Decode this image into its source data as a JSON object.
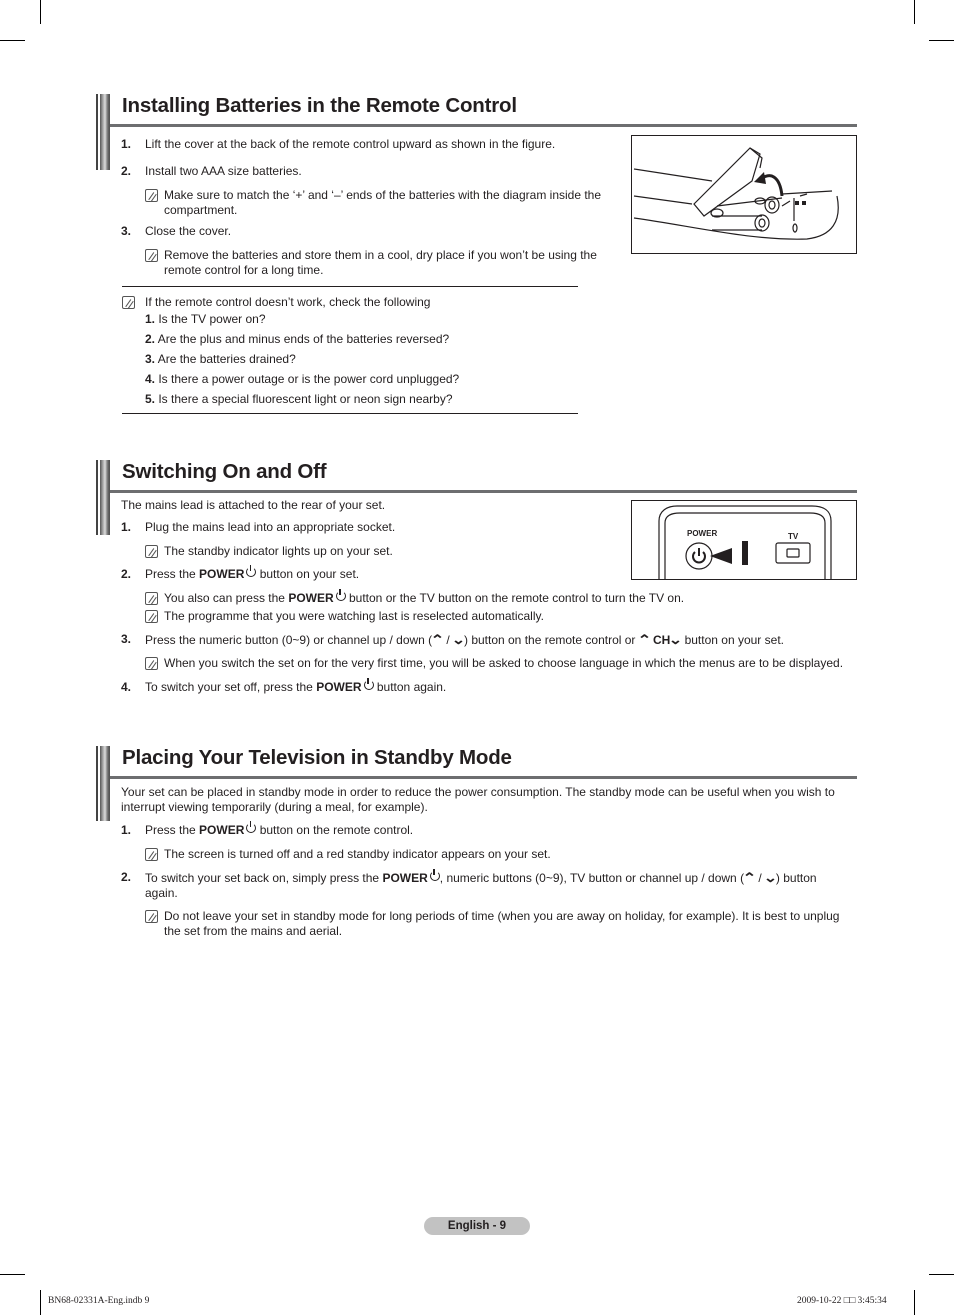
{
  "sections": {
    "batteries": {
      "title": "Installing Batteries in the Remote Control",
      "steps": [
        {
          "num": "1.",
          "text": "Lift the cover at the back of the remote control upward as shown in the figure."
        },
        {
          "num": "2.",
          "text": "Install two AAA size batteries."
        },
        {
          "num": "3.",
          "text": "Close the cover."
        }
      ],
      "notes": [
        "Make sure to match the ‘+’ and ‘–’ ends of the batteries with the diagram inside the compartment.",
        "Remove the batteries and store them in a cool, dry place if you won’t be using the remote control for a long time."
      ],
      "check": {
        "intro": "If the remote control doesn’t work, check the following",
        "items": [
          {
            "num": "1.",
            "text": " Is the TV power on?"
          },
          {
            "num": "2.",
            "text": " Are the plus and minus ends of the batteries reversed?"
          },
          {
            "num": "3.",
            "text": " Are the batteries drained?"
          },
          {
            "num": "4.",
            "text": " Is there a power outage or is the power cord unplugged?"
          },
          {
            "num": "5.",
            "text": " Is there a special fluorescent light or neon sign nearby?"
          }
        ]
      },
      "figure": {
        "description": "remote control battery compartment with cover lifted"
      }
    },
    "switching": {
      "title": "Switching On and Off",
      "intro": "The mains lead is attached to the rear of your set.",
      "step1": {
        "num": "1.",
        "text": "Plug the mains lead into an appropriate socket."
      },
      "note1": "The standby indicator lights up on your set.",
      "step2": {
        "num": "2.",
        "pre": "Press the ",
        "bold": "POWER",
        "post": " button on your set."
      },
      "note2a": {
        "pre": "You also can press the ",
        "bold": "POWER",
        "post": "  button or the TV button on the remote control to turn the TV on."
      },
      "note2b": "The programme that you were watching last is reselected automatically.",
      "step3": {
        "num": "3.",
        "pre": "Press the numeric button (0~9) or channel up / down (",
        "mid": " / ",
        "post": ") button on the remote control or ",
        "ch": "CH",
        "end": " button on your set."
      },
      "note3": "When you switch the set on for the very first time, you will be asked to choose language in which the menus are to be displayed.",
      "step4": {
        "num": "4.",
        "pre": "To switch your set off, press the ",
        "bold": "POWER",
        "post": " button again."
      },
      "figure": {
        "power_label": "POWER",
        "tv_label": "TV"
      }
    },
    "standby": {
      "title": "Placing Your Television in Standby Mode",
      "intro": "Your set can be placed in standby mode in order to reduce the power consumption. The standby mode can be useful when you wish to interrupt viewing temporarily (during a meal, for example).",
      "step1": {
        "num": "1.",
        "pre": "Press the ",
        "bold": "POWER",
        "post": " button on the remote control."
      },
      "note1": "The screen is turned off and a red standby indicator appears on your set.",
      "step2": {
        "num": "2.",
        "pre": "To switch your set back on, simply press the ",
        "bold": "POWER",
        "post": ", numeric buttons (0~9), TV button or channel up / down (",
        "mid": " / ",
        "end": ") button again."
      },
      "note2": "Do not leave your set in standby mode for long periods of time (when you are away on holiday, for example). It is best to unplug the set from the mains and aerial."
    }
  },
  "footer": {
    "page_label": "English - 9",
    "slug_left": "BN68-02331A-Eng.indb   9",
    "slug_right": "2009-10-22   □□ 3:45:34"
  }
}
